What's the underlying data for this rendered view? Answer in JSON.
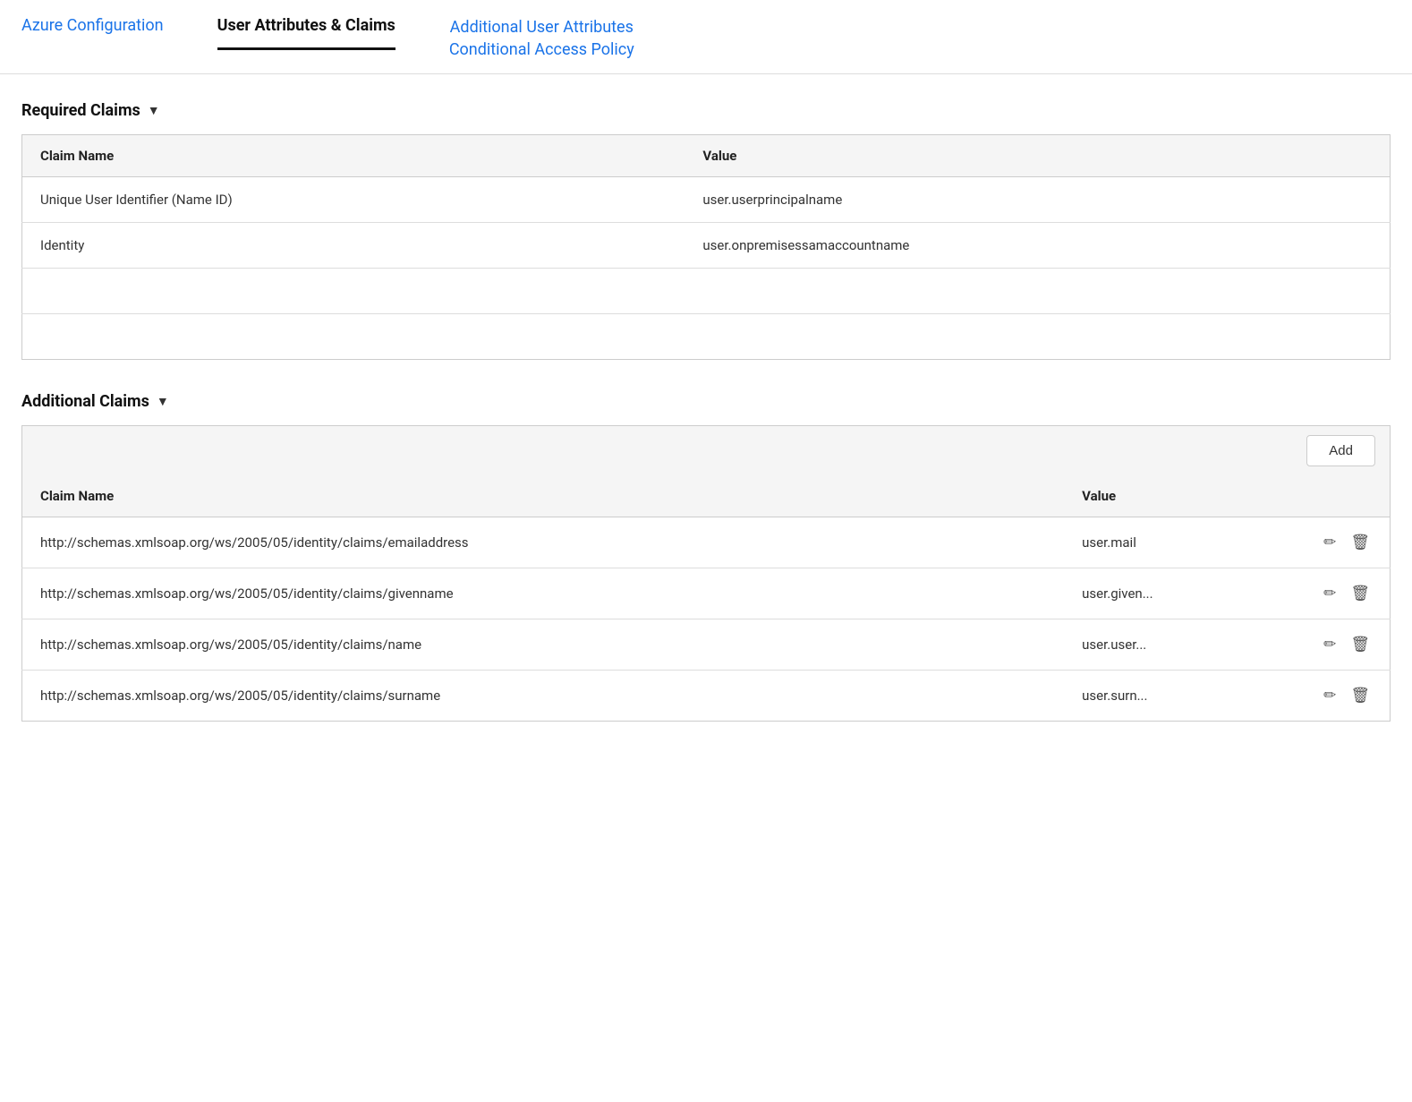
{
  "nav": {
    "items": [
      {
        "id": "azure-config",
        "label": "Azure Configuration",
        "active": false,
        "multiline": false
      },
      {
        "id": "user-attributes",
        "label": "User Attributes & Claims",
        "active": true,
        "multiline": false
      },
      {
        "id": "additional-user",
        "label": "Additional User Attributes\nConditional Access Policy",
        "active": false,
        "multiline": true
      }
    ]
  },
  "required_claims": {
    "section_title": "Required Claims",
    "chevron": "▼",
    "columns": [
      "Claim Name",
      "Value"
    ],
    "rows": [
      {
        "claim_name": "Unique User Identifier (Name ID)",
        "value": "user.userprincipalname"
      },
      {
        "claim_name": "Identity",
        "value": "user.onpremisessamaccountname"
      }
    ]
  },
  "additional_claims": {
    "section_title": "Additional Claims",
    "chevron": "▼",
    "add_button_label": "Add",
    "columns": [
      "Claim Name",
      "Value"
    ],
    "rows": [
      {
        "claim_name": "http://schemas.xmlsoap.org/ws/2005/05/identity/claims/emailaddress",
        "value": "user.mail"
      },
      {
        "claim_name": "http://schemas.xmlsoap.org/ws/2005/05/identity/claims/givenname",
        "value": "user.given..."
      },
      {
        "claim_name": "http://schemas.xmlsoap.org/ws/2005/05/identity/claims/name",
        "value": "user.user..."
      },
      {
        "claim_name": "http://schemas.xmlsoap.org/ws/2005/05/identity/claims/surname",
        "value": "user.surn..."
      }
    ]
  },
  "icons": {
    "pencil": "✎",
    "trash": "🗑"
  }
}
